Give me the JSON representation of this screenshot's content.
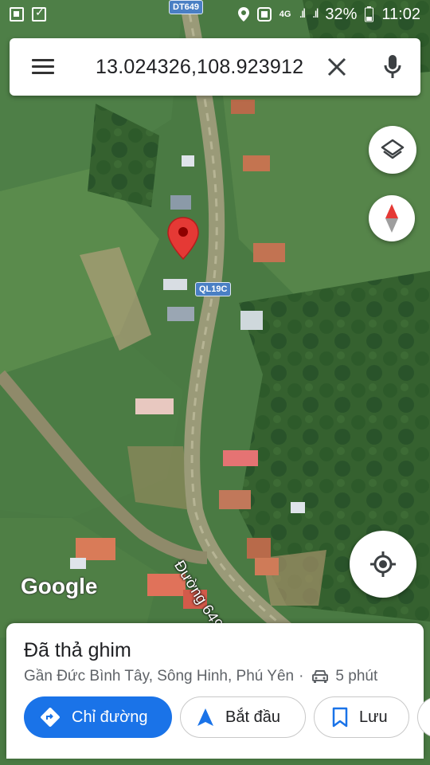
{
  "status_bar": {
    "network": "4G",
    "battery": "32%",
    "time": "11:02"
  },
  "search": {
    "query": "13.024326,108.923912",
    "menu_icon": "hamburger-icon",
    "clear_icon": "close-icon",
    "mic_icon": "mic-icon"
  },
  "map": {
    "road_shield_top": "DT649",
    "road_shield_mid": "QL19C",
    "road_name": "Đường 649",
    "attribution": "Google",
    "pin_color": "#e53935"
  },
  "place_card": {
    "title": "Đã thả ghim",
    "subtitle": "Gần Đức Bình Tây, Sông Hinh, Phú Yên",
    "separator": "·",
    "drive_time": "5 phút",
    "buttons": {
      "directions": "Chỉ đường",
      "start": "Bắt đầu",
      "save": "Lưu"
    }
  },
  "colors": {
    "accent": "#1a73e8"
  }
}
